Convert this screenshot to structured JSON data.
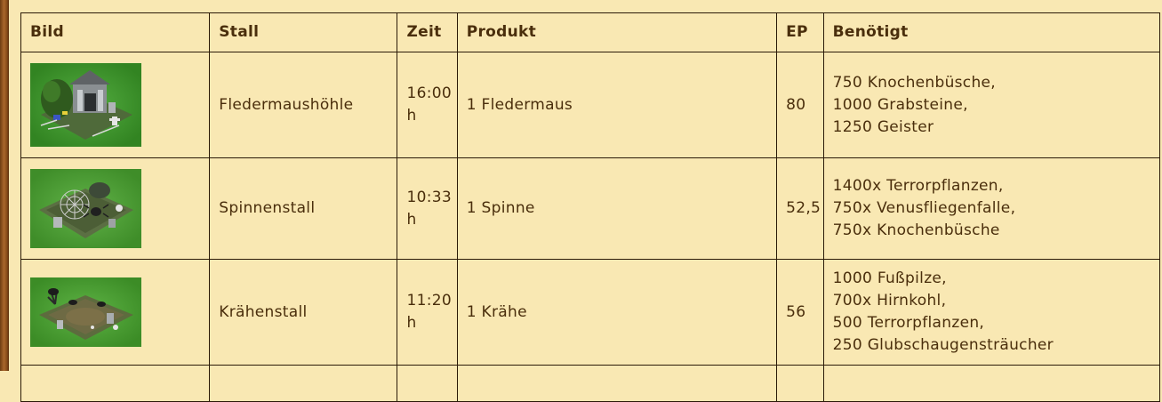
{
  "table": {
    "headers": {
      "bild": "Bild",
      "stall": "Stall",
      "zeit": "Zeit",
      "produkt": "Produkt",
      "ep": "EP",
      "benoetigt": "Benötigt"
    },
    "rows": [
      {
        "image": "bat-cave-mausoleum-thumbnail",
        "stall": "Fledermaushöhle",
        "zeit": "16:00 h",
        "produkt": "1 Fledermaus",
        "ep": "80",
        "benoetigt": [
          "750 Knochenbüsche,",
          "1000 Grabsteine,",
          "1250 Geister"
        ]
      },
      {
        "image": "spider-stable-thumbnail",
        "stall": "Spinnenstall",
        "zeit": "10:33 h",
        "produkt": "1 Spinne",
        "ep": "52,5",
        "benoetigt": [
          "1400x Terrorpflanzen,",
          "750x Venusfliegenfalle,",
          "750x Knochenbüsche"
        ]
      },
      {
        "image": "crow-stable-thumbnail",
        "stall": "Krähenstall",
        "zeit": "11:20 h",
        "produkt": "1 Krähe",
        "ep": "56",
        "benoetigt": [
          "1000 Fußpilze,",
          "700x Hirnkohl,",
          "500 Terrorpflanzen,",
          "250 Glubschaugensträucher"
        ]
      }
    ]
  },
  "colors": {
    "background": "#f9e8b3",
    "text": "#4a2e0c",
    "border": "#2b1a08",
    "grass": "#3d9a2a"
  }
}
